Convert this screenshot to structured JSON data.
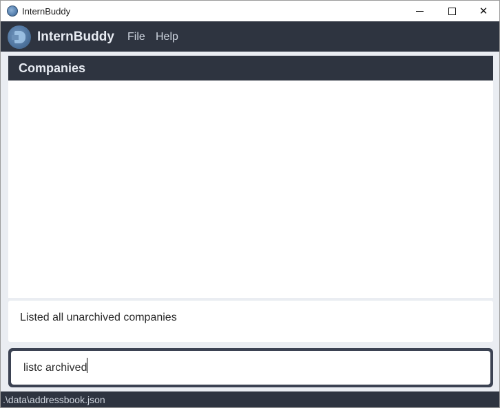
{
  "window": {
    "title": "InternBuddy",
    "icon": "app-logo-icon"
  },
  "menubar": {
    "brand": "InternBuddy",
    "items": [
      {
        "label": "File"
      },
      {
        "label": "Help"
      }
    ]
  },
  "panel": {
    "title": "Companies",
    "items": []
  },
  "result": {
    "text": "Listed all unarchived companies"
  },
  "command": {
    "value": "listc archived"
  },
  "status": {
    "path": ".\\data\\addressbook.json"
  },
  "colors": {
    "dark": "#2e3440",
    "command_border": "#3b4252",
    "background": "#eaedf2"
  }
}
